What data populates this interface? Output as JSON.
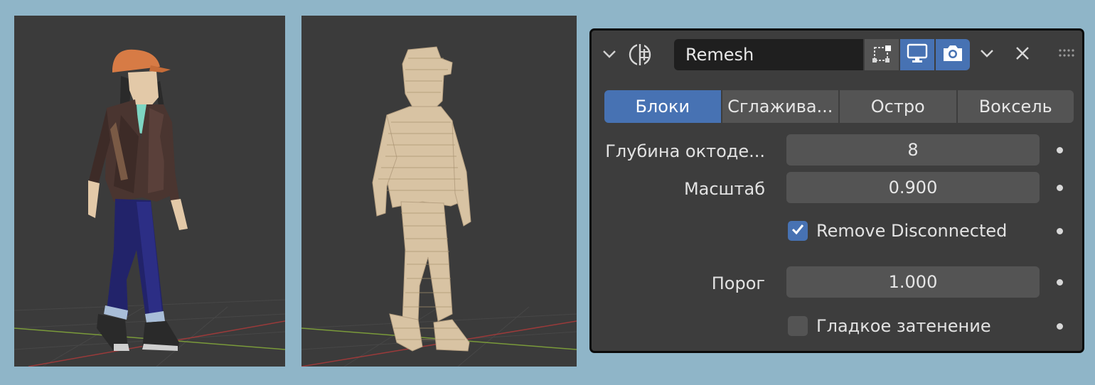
{
  "modifier": {
    "name": "Remesh",
    "icons": {
      "collapse": "chevron-down-icon",
      "type": "remesh-modifier-icon",
      "edit_mode": "edit-mode-icon",
      "viewport": "monitor-icon",
      "render": "camera-icon",
      "dropdown": "chevron-down-icon",
      "close": "close-icon",
      "drag": "drag-handle-icon"
    },
    "toggles": {
      "edit_mode": false,
      "viewport": true,
      "render": true
    }
  },
  "tabs": [
    {
      "label": "Блоки",
      "active": true
    },
    {
      "label": "Сглажива...",
      "active": false
    },
    {
      "label": "Остро",
      "active": false
    },
    {
      "label": "Воксель",
      "active": false
    }
  ],
  "fields": {
    "octree_depth": {
      "label": "Глубина октоде...",
      "value": "8"
    },
    "scale": {
      "label": "Масштаб",
      "value": "0.900"
    },
    "remove_disconnected": {
      "label": "Remove Disconnected",
      "checked": true
    },
    "threshold": {
      "label": "Порог",
      "value": "1.000"
    },
    "smooth_shading": {
      "label": "Гладкое затенение",
      "checked": false
    }
  },
  "colors": {
    "background": "#8fb5c8",
    "viewport": "#3b3b3b",
    "panel": "#3d3d3d",
    "field": "#545454",
    "accent": "#4772b3",
    "voxel": "#d8c3a3"
  },
  "viewports": [
    {
      "content": "low-poly-character-original"
    },
    {
      "content": "voxel-remeshed-character"
    }
  ]
}
